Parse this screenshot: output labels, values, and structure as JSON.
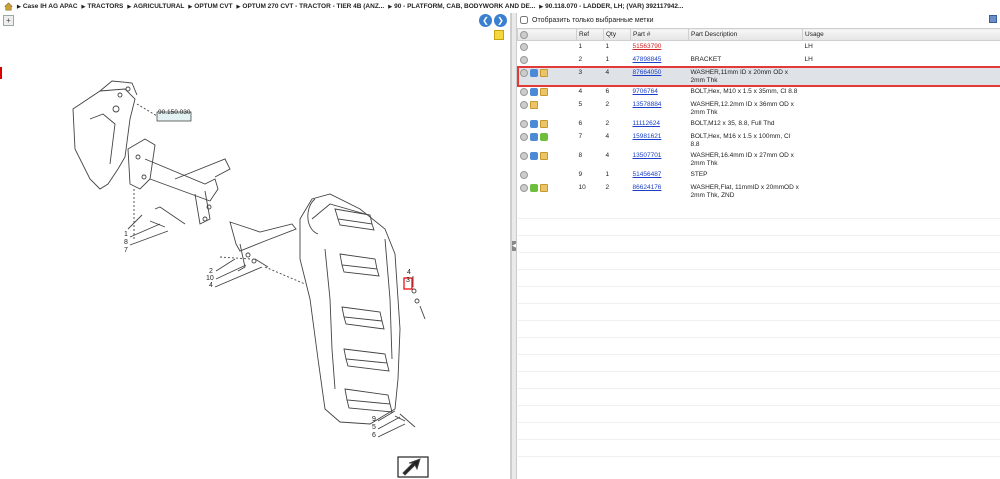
{
  "breadcrumb": [
    "Case IH AG APAC",
    "TRACTORS",
    "AGRICULTURAL",
    "OPTUM CVT",
    "OPTUM 270 CVT - TRACTOR - TIER 4B (ANZ...",
    "90 - PLATFORM, CAB, BODYWORK AND DE...",
    "90.118.070 - LADDER, LH; (VAR) 392117942..."
  ],
  "diagram": {
    "ref_box": "90.150.030",
    "callouts_left": [
      "1",
      "8",
      "7",
      "2",
      "10",
      "4"
    ],
    "callouts_right": [
      "4",
      "3"
    ],
    "callouts_bottom": [
      "9",
      "5",
      "6"
    ]
  },
  "filter_label": "Отобразить только выбранные метки",
  "columns": {
    "ref": "Ref",
    "qty": "Qty",
    "part": "Part #",
    "desc": "Part Description",
    "usage": "Usage"
  },
  "rows": [
    {
      "ref": "1",
      "qty": "1",
      "part": "51563790",
      "desc": "",
      "usage": "LH",
      "icons": [
        "gear"
      ],
      "red": true
    },
    {
      "ref": "2",
      "qty": "1",
      "part": "47898845",
      "desc": "BRACKET",
      "usage": "LH",
      "icons": [
        "gear"
      ]
    },
    {
      "ref": "3",
      "qty": "4",
      "part": "87664050",
      "desc": "WASHER,11mm ID x 20mm OD x 2mm Thk",
      "usage": "",
      "icons": [
        "gear",
        "arrow",
        "box"
      ],
      "selected": true
    },
    {
      "ref": "4",
      "qty": "6",
      "part": "9706764",
      "desc": "BOLT,Hex, M10 x 1.5 x 35mm, Cl 8.8",
      "usage": "",
      "icons": [
        "gear",
        "arrow",
        "box"
      ]
    },
    {
      "ref": "5",
      "qty": "2",
      "part": "13578884",
      "desc": "WASHER,12.2mm ID x 36mm OD x 2mm Thk",
      "usage": "",
      "icons": [
        "gear",
        "box"
      ]
    },
    {
      "ref": "6",
      "qty": "2",
      "part": "11112624",
      "desc": "BOLT,M12 x 35, 8.8, Full Thd",
      "usage": "",
      "icons": [
        "gear",
        "arrow",
        "box"
      ]
    },
    {
      "ref": "7",
      "qty": "4",
      "part": "15981621",
      "desc": "BOLT,Hex, M16 x 1.5 x 100mm, Cl 8.8",
      "usage": "",
      "icons": [
        "gear",
        "arrow",
        "arrowgreen"
      ]
    },
    {
      "ref": "8",
      "qty": "4",
      "part": "13507701",
      "desc": "WASHER,16.4mm ID x 27mm OD x 2mm Thk",
      "usage": "",
      "icons": [
        "gear",
        "arrow",
        "box"
      ]
    },
    {
      "ref": "9",
      "qty": "1",
      "part": "51456487",
      "desc": "STEP",
      "usage": "",
      "icons": [
        "gear"
      ]
    },
    {
      "ref": "10",
      "qty": "2",
      "part": "86624176",
      "desc": "WASHER,Flat, 11mmID x 20mmOD x 2mm Thk, ZND",
      "usage": "",
      "icons": [
        "gear",
        "arrowgreen",
        "box"
      ]
    }
  ]
}
